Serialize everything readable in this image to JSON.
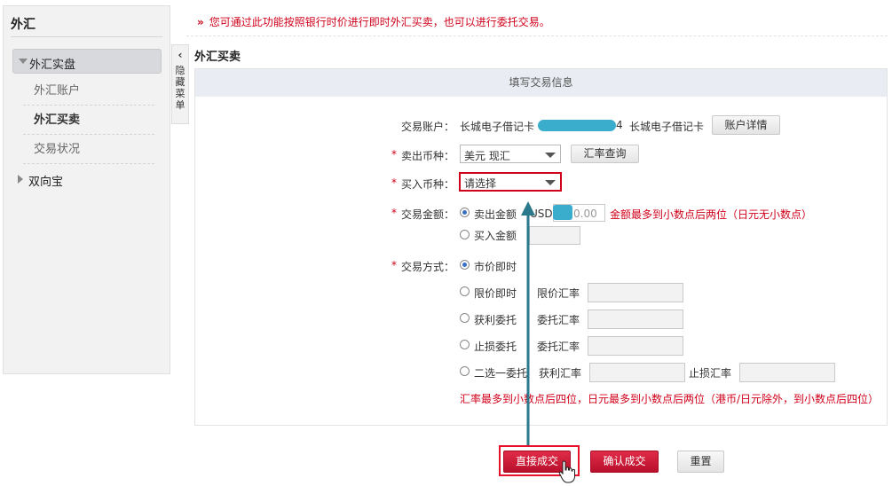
{
  "sidebar": {
    "title": "外汇",
    "group1": "外汇实盘",
    "items": [
      "外汇账户",
      "外汇买卖",
      "交易状况"
    ],
    "group2": "双向宝"
  },
  "hide_menu": {
    "chevron": "‹",
    "label": "隐藏菜单"
  },
  "notice": {
    "mark": "»",
    "text": "您可通过此功能按照银行时价进行即时外汇买卖，也可以进行委托交易。"
  },
  "section_title": "外汇买卖",
  "form_header": "填写交易信息",
  "form": {
    "account": {
      "label": "交易账户：",
      "card_type": "长城电子借记卡",
      "card_tail": "4",
      "card_type2": "长城电子借记卡",
      "detail_button": "账户详情"
    },
    "sell_currency": {
      "label": "卖出币种：",
      "value": "美元  现汇",
      "rate_button": "汇率查询"
    },
    "buy_currency": {
      "label": "买入币种：",
      "value": "请选择"
    },
    "amount": {
      "label": "交易金额：",
      "sell_option": "卖出金额",
      "currency": "USD",
      "value": "0.00",
      "hint": "金额最多到小数点后两位（日元无小数点）",
      "buy_option": "买入金额"
    },
    "trade_method": {
      "label": "交易方式：",
      "market": "市价即时",
      "limit": "限价即时",
      "limit_rate": "限价汇率",
      "profit": "获利委托",
      "profit_rate": "委托汇率",
      "stop": "止损委托",
      "stop_rate": "委托汇率",
      "oco": "二选一委托",
      "oco_profit_rate": "获利汇率",
      "oco_stop_rate": "止损汇率"
    },
    "rate_hint": "汇率最多到小数点后四位，日元最多到小数点后两位（港币/日元除外，到小数点后四位）"
  },
  "buttons": {
    "direct": "直接成交",
    "confirm": "确认成交",
    "reset": "重置"
  },
  "required_mark": "*",
  "colors": {
    "accent_red": "#d0021b",
    "primary_button": "#c41230",
    "annotation_arrow": "#2b7a8c",
    "redaction": "#3aaccc"
  }
}
